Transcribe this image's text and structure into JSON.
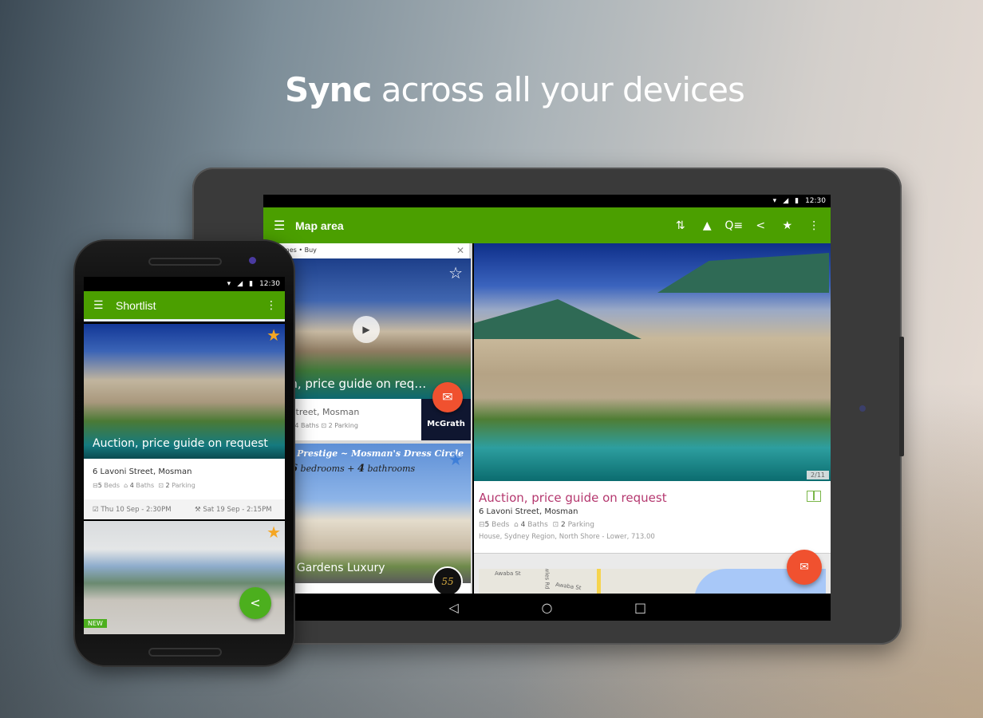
{
  "headline": {
    "bold": "Sync",
    "rest": "across all your devices"
  },
  "tablet": {
    "status": {
      "time": "12:30",
      "wifi_icon": "wifi-icon",
      "signal_icon": "signal-icon",
      "battery_icon": "battery-icon"
    },
    "appbar": {
      "title": "Map area",
      "menu_icon": "☰",
      "actions": [
        {
          "name": "sort-icon",
          "glyph": "⇅"
        },
        {
          "name": "bell-icon",
          "glyph": "🔔"
        },
        {
          "name": "search-filter-icon",
          "glyph": "🔍"
        },
        {
          "name": "share-icon",
          "glyph": "<"
        },
        {
          "name": "star-icon",
          "glyph": "★"
        },
        {
          "name": "more-icon",
          "glyph": "⋮"
        }
      ]
    },
    "list": {
      "breadcrumb": "omes • Buy",
      "close_icon": "✕",
      "cards": [
        {
          "price": "ion, price guide on req…",
          "address": "ni Street, Mosman",
          "features": "ds  ⌂ 4 Baths  ⊡ 2 Parking",
          "agency": "McGrath"
        },
        {
          "banner_line1": "y & Prestige ~ Mosman's Dress Circle",
          "banner_line2_num1": "6",
          "banner_line2_text1": "bedrooms +",
          "banner_line2_num2": "4",
          "banner_line2_text2": "bathrooms",
          "title": "on Gardens Luxury",
          "badge": "55"
        }
      ]
    },
    "detail": {
      "photo_counter": "2/11",
      "price": "Auction, price guide on request",
      "address": "6 Lavoni Street, Mosman",
      "beds": "5",
      "beds_label": "Beds",
      "baths": "4",
      "baths_label": "Baths",
      "parking": "2",
      "parking_label": "Parking",
      "meta": "House, Sydney Region, North Shore - Lower, 713.00"
    },
    "map": {
      "streets": [
        "Awaba St",
        "Awaba St",
        "owles Rd"
      ]
    },
    "nav": {
      "back": "◁",
      "home": "○",
      "recents": "□"
    }
  },
  "phone": {
    "status": {
      "time": "12:30"
    },
    "appbar": {
      "title": "Shortlist",
      "menu_icon": "☰",
      "more_icon": "⋮"
    },
    "cards": [
      {
        "price": "Auction, price guide on request",
        "address": "6 Lavoni Street, Mosman",
        "beds": "5",
        "beds_label": "Beds",
        "baths": "4",
        "baths_label": "Baths",
        "parking": "2",
        "parking_label": "Parking",
        "inspection": "Thu 10 Sep - 2:30PM",
        "auction": "Sat 19 Sep - 2:15PM"
      },
      {
        "badge": "NEW"
      }
    ]
  },
  "colors": {
    "brand_green": "#4b9f00",
    "price_magenta": "#b5386f",
    "fab_orange": "#f0512f",
    "star_orange": "#f5a623"
  }
}
